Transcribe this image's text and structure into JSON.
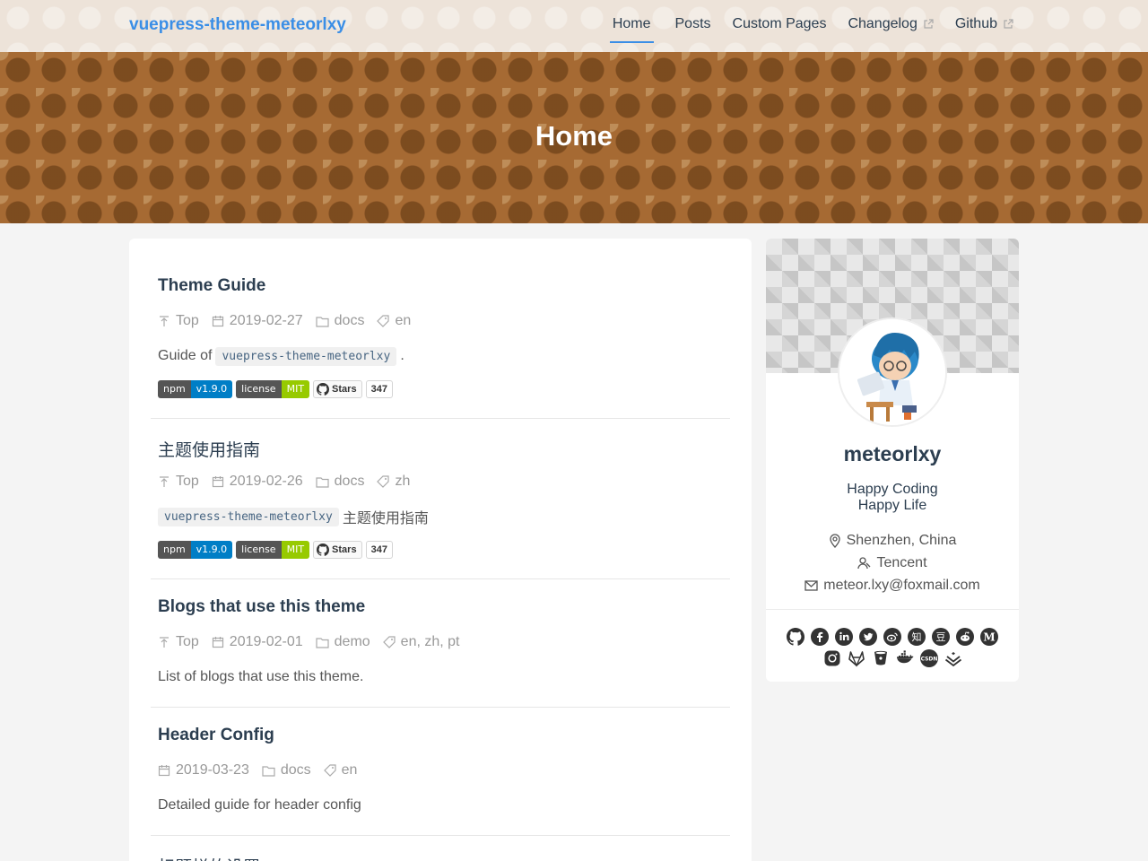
{
  "navbar": {
    "brand": "vuepress-theme-meteorlxy",
    "items": [
      {
        "label": "Home",
        "active": true,
        "external": false
      },
      {
        "label": "Posts",
        "active": false,
        "external": false
      },
      {
        "label": "Custom Pages",
        "active": false,
        "external": false
      },
      {
        "label": "Changelog",
        "active": false,
        "external": true
      },
      {
        "label": "Github",
        "active": false,
        "external": true
      }
    ]
  },
  "banner": {
    "title": "Home"
  },
  "posts": [
    {
      "title": "Theme Guide",
      "top": "Top",
      "date": "2019-02-27",
      "category": "docs",
      "tags": "en",
      "summary_before": "Guide of",
      "summary_code": "vuepress-theme-meteorlxy",
      "summary_after": ".",
      "badges": {
        "npm_label": "npm",
        "npm_value": "v1.9.0",
        "license_label": "license",
        "license_value": "MIT",
        "stars_label": "Stars",
        "stars_count": "347"
      }
    },
    {
      "title": "主题使用指南",
      "top": "Top",
      "date": "2019-02-26",
      "category": "docs",
      "tags": "zh",
      "summary_code": "vuepress-theme-meteorlxy",
      "summary_after": "主题使用指南",
      "badges": {
        "npm_label": "npm",
        "npm_value": "v1.9.0",
        "license_label": "license",
        "license_value": "MIT",
        "stars_label": "Stars",
        "stars_count": "347"
      }
    },
    {
      "title": "Blogs that use this theme",
      "top": "Top",
      "date": "2019-02-01",
      "category": "demo",
      "tags": "en, zh, pt",
      "summary": "List of blogs that use this theme."
    },
    {
      "title": "Header Config",
      "date": "2019-03-23",
      "category": "docs",
      "tags": "en",
      "summary": "Detailed guide for header config"
    },
    {
      "title": "标题栏的设置"
    }
  ],
  "profile": {
    "name": "meteorlxy",
    "bio_line1": "Happy Coding",
    "bio_line2": "Happy Life",
    "location": "Shenzhen, China",
    "organization": "Tencent",
    "email": "meteor.lxy@foxmail.com",
    "socials": [
      "github-icon",
      "facebook-icon",
      "linkedin-icon",
      "twitter-icon",
      "weibo-icon",
      "zhihu-icon",
      "douban-icon",
      "reddit-icon",
      "medium-icon",
      "instagram-icon",
      "gitlab-icon",
      "bitbucket-icon",
      "docker-icon",
      "csdn-icon",
      "juejin-icon"
    ]
  },
  "colors": {
    "brand": "#3a8ee6",
    "banner": "#a66a33",
    "navbar": "#ede3d9",
    "text": "#2c3e50",
    "meta": "#999999",
    "npm_badge": "#007ec6",
    "license_badge": "#97ca00"
  }
}
